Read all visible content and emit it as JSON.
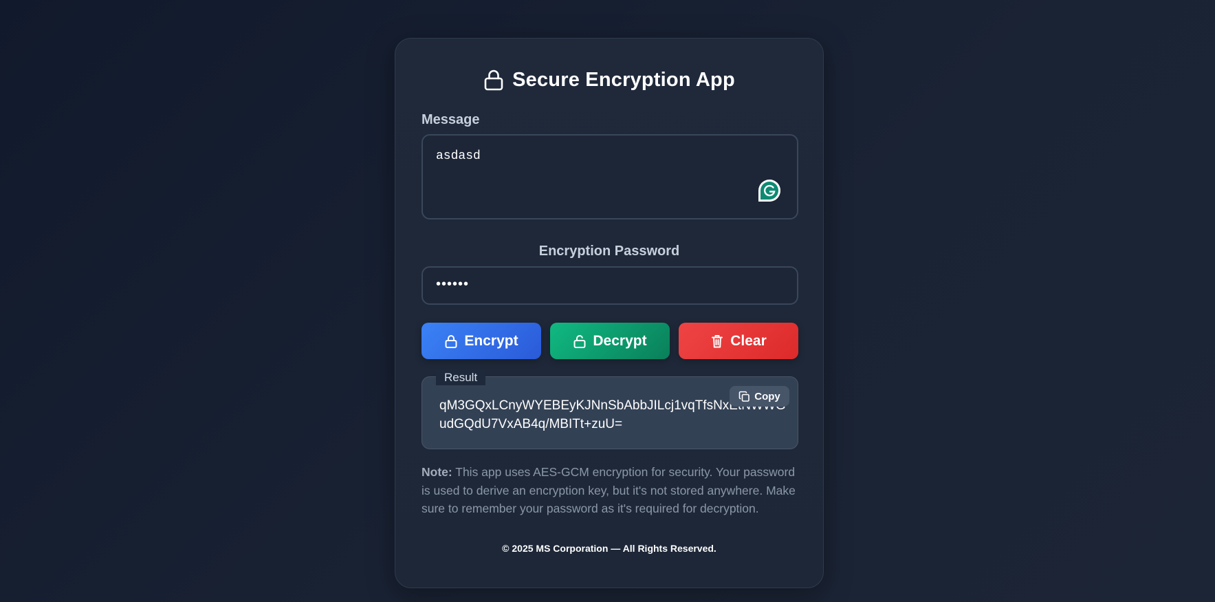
{
  "app": {
    "title": "Secure Encryption App",
    "title_icon": "lock-icon"
  },
  "message": {
    "label": "Message",
    "value": "asdasd",
    "extension_icon": "grammarly-icon"
  },
  "password": {
    "label": "Encryption Password",
    "masked_value": "••••••"
  },
  "actions": {
    "encrypt_label": "Encrypt",
    "decrypt_label": "Decrypt",
    "clear_label": "Clear",
    "encrypt_icon": "lock-icon",
    "decrypt_icon": "unlock-icon",
    "clear_icon": "trash-icon"
  },
  "result": {
    "label": "Result",
    "copy_label": "Copy",
    "copy_icon": "copy-icon",
    "value": "qM3GQxLCnyWYEBEyKJNnSbAbbJILcj1vqTfsNxEtNWWGudGQdU7VxAB4q/MBITt+zuU="
  },
  "note": {
    "strong": "Note:",
    "text": " This app uses AES-GCM encryption for security. Your password is used to derive an encryption key, but it's not stored anywhere. Make sure to remember your password as it's required for decryption."
  },
  "footer": {
    "text": "© 2025 MS Corporation — All Rights Reserved."
  },
  "colors": {
    "encrypt": "#3b82f6",
    "decrypt": "#10b981",
    "clear": "#ef4444",
    "card": "#1f293a",
    "result_bg": "#334155"
  }
}
